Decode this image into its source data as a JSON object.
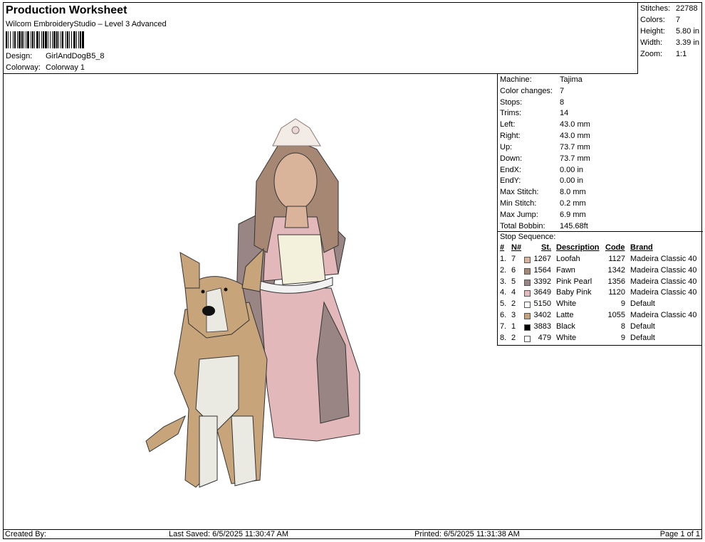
{
  "header": {
    "title": "Production Worksheet",
    "software": "Wilcom EmbroideryStudio – Level 3 Advanced",
    "design_label": "Design:",
    "design_value": "GirlAndDogB5_8",
    "colorway_label": "Colorway:",
    "colorway_value": "Colorway 1"
  },
  "stats": [
    {
      "label": "Stitches:",
      "value": "22788"
    },
    {
      "label": "Colors:",
      "value": "7"
    },
    {
      "label": "Height:",
      "value": "5.80 in"
    },
    {
      "label": "Width:",
      "value": "3.39 in"
    },
    {
      "label": "Zoom:",
      "value": "1:1"
    }
  ],
  "machine_info": [
    {
      "label": "Machine:",
      "value": "Tajima"
    },
    {
      "label": "Color changes:",
      "value": "7"
    },
    {
      "label": "Stops:",
      "value": "8"
    },
    {
      "label": "Trims:",
      "value": "14"
    },
    {
      "label": "Left:",
      "value": "43.0 mm"
    },
    {
      "label": "Right:",
      "value": "43.0 mm"
    },
    {
      "label": "Up:",
      "value": "73.7 mm"
    },
    {
      "label": "Down:",
      "value": "73.7 mm"
    },
    {
      "label": "EndX:",
      "value": "0.00 in"
    },
    {
      "label": "EndY:",
      "value": "0.00 in"
    },
    {
      "label": "Max Stitch:",
      "value": "8.0 mm"
    },
    {
      "label": "Min Stitch:",
      "value": "0.2 mm"
    },
    {
      "label": "Max Jump:",
      "value": "6.9 mm"
    },
    {
      "label": "Total Bobbin:",
      "value": "145.68ft"
    }
  ],
  "stop_sequence": {
    "title": "Stop Sequence:",
    "headers": {
      "num": "#",
      "n": "N#",
      "st": "St.",
      "desc": "Description",
      "code": "Code",
      "brand": "Brand"
    },
    "rows": [
      {
        "num": "1.",
        "n": "7",
        "color": "#d9b49a",
        "st": "1267",
        "desc": "Loofah",
        "code": "1127",
        "brand": "Madeira Classic 40"
      },
      {
        "num": "2.",
        "n": "6",
        "color": "#a68774",
        "st": "1564",
        "desc": "Fawn",
        "code": "1342",
        "brand": "Madeira Classic 40"
      },
      {
        "num": "3.",
        "n": "5",
        "color": "#9a8585",
        "st": "3392",
        "desc": "Pink Pearl",
        "code": "1356",
        "brand": "Madeira Classic 40"
      },
      {
        "num": "4.",
        "n": "4",
        "color": "#e8b8bf",
        "st": "3649",
        "desc": "Baby Pink",
        "code": "1120",
        "brand": "Madeira Classic 40"
      },
      {
        "num": "5.",
        "n": "2",
        "color": "#ffffff",
        "st": "5150",
        "desc": "White",
        "code": "9",
        "brand": "Default"
      },
      {
        "num": "6.",
        "n": "3",
        "color": "#c7a47a",
        "st": "3402",
        "desc": "Latte",
        "code": "1055",
        "brand": "Madeira Classic 40"
      },
      {
        "num": "7.",
        "n": "1",
        "color": "#000000",
        "st": "3883",
        "desc": "Black",
        "code": "8",
        "brand": "Default"
      },
      {
        "num": "8.",
        "n": "2",
        "color": "#ffffff",
        "st": "479",
        "desc": "White",
        "code": "9",
        "brand": "Default"
      }
    ]
  },
  "footer": {
    "created_by": "Created By:",
    "last_saved": "Last Saved: 6/5/2025 11:30:47 AM",
    "printed": "Printed: 6/5/2025 11:31:38 AM",
    "page": "Page 1 of 1"
  }
}
